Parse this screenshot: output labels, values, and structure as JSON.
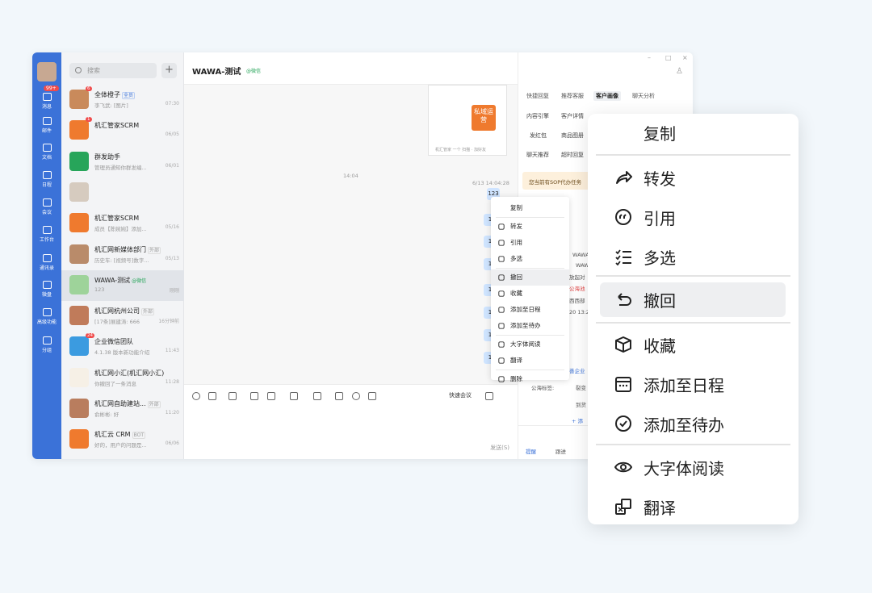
{
  "app": {
    "chat_title": "WAWA-测试",
    "chat_sub": "@微信",
    "timestamps": [
      "14:04",
      "6/13 14:04:28"
    ],
    "my_bubble": "123",
    "bubble_stub": "1",
    "img_card": {
      "poster_text": "私域运营",
      "caption": "机汇管家 一个 扫描 · 加好友"
    },
    "quick_meeting": "快速会议",
    "send_hint": "发送(S)"
  },
  "rail": {
    "badge": "99+",
    "items": [
      "消息",
      "邮件",
      "文档",
      "日程",
      "会议",
      "工作台",
      "通讯录",
      "微盘",
      "高级功能",
      "分组"
    ]
  },
  "convs": {
    "search_placeholder": "搜索",
    "plus": "+",
    "list": [
      {
        "name": "全体橙子",
        "tag": "全员",
        "preview": "李飞武: [图片]",
        "time": "07:30",
        "badge": "6",
        "color": "#c98a5b"
      },
      {
        "name": "机汇管家SCRM",
        "preview": "",
        "time": "06/05",
        "badge": "1",
        "color": "#ef7a2e"
      },
      {
        "name": "群发助手",
        "preview": "管理员通知你群发编...",
        "time": "06/01",
        "color": "#27a55a"
      },
      {
        "name": "",
        "preview": "",
        "time": "",
        "color": "#d6cbbf"
      },
      {
        "name": "机汇管家SCRM",
        "preview": "成员【陈婉婉】添加...",
        "time": "05/16",
        "color": "#ef7a2e"
      },
      {
        "name": "机汇网新媒体部门",
        "tag": "外部",
        "preview": "历史车: [视频号]数字...",
        "time": "05/13",
        "color": "#b98b6a"
      },
      {
        "name": "WAWA-测试",
        "tag": "@微信",
        "preview": "123",
        "time": "刚刚",
        "color": "#9ed39a"
      },
      {
        "name": "机汇网杭州公司",
        "tag": "外部",
        "preview": "[17条]展建涛: 666",
        "time": "16分钟前",
        "color": "#c07b5a"
      },
      {
        "name": "企业微信团队",
        "preview": "4.1.38 版本新功能介绍",
        "time": "11:43",
        "badge": "24",
        "color": "#3b9be0"
      },
      {
        "name": "机汇网小汇(机汇网小汇)",
        "preview": "你撤回了一条消息",
        "time": "11:28",
        "color": "#f6f0e6"
      },
      {
        "name": "机汇网自助建站...",
        "tag": "外部",
        "preview": "俞彬彬: 好",
        "time": "11:20",
        "color": "#b97d5e"
      },
      {
        "name": "机汇云 CRM",
        "tag": "BOT",
        "preview": "好的，用户的问题是...",
        "time": "06/06",
        "color": "#ef7a2e"
      }
    ]
  },
  "right": {
    "tabs": [
      "快捷回复",
      "推荐客服",
      "客户画像",
      "聊天分析"
    ],
    "buttons": [
      "内容引擎",
      "客户详情",
      "发红包",
      "商品图册",
      "聊天推荐",
      "超时回复"
    ],
    "sop": "您当前有SOP代办任务",
    "frags": [
      "WAWA-",
      "WAWA",
      "放起对",
      "公海池",
      "西西部",
      "20 13:2",
      "善企业",
      "公海标签:",
      "裂变",
      "到货",
      "+ 添"
    ],
    "bottom": [
      "提醒",
      "跟进"
    ]
  },
  "menu_small": [
    "复制",
    "转发",
    "引用",
    "多选",
    "撤回",
    "收藏",
    "添加至日程",
    "添加至待办",
    "大字体阅读",
    "翻译",
    "删除"
  ],
  "menu_big": [
    "复制",
    "转发",
    "引用",
    "多选",
    "撤回",
    "收藏",
    "添加至日程",
    "添加至待办",
    "大字体阅读",
    "翻译"
  ]
}
